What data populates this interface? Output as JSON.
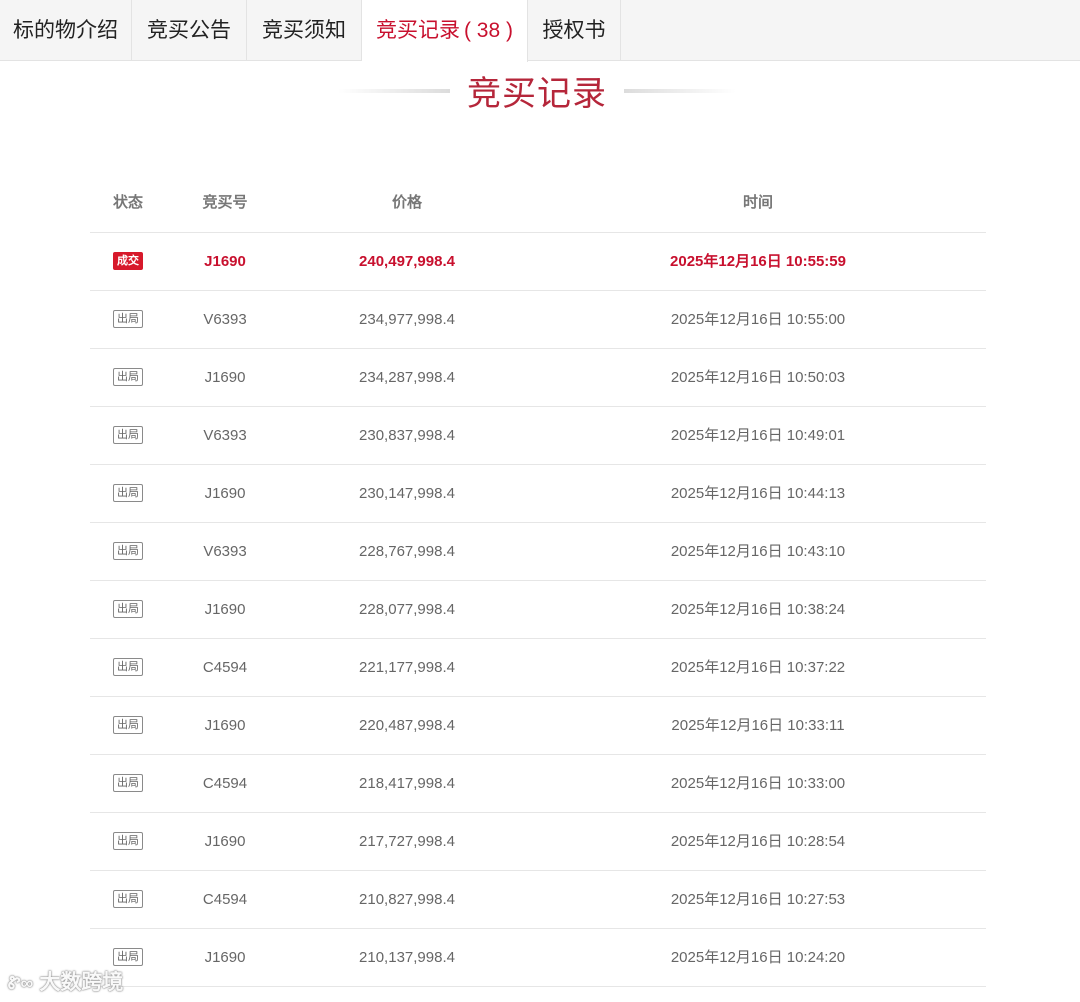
{
  "tabs": [
    {
      "label": "标的物介绍"
    },
    {
      "label": "竞买公告"
    },
    {
      "label": "竞买须知"
    },
    {
      "label": "竞买记录",
      "count": "( 38 )"
    },
    {
      "label": "授权书"
    }
  ],
  "section_title": "竞买记录",
  "table": {
    "headers": {
      "status": "状态",
      "number": "竞买号",
      "price": "价格",
      "time": "时间"
    },
    "rows": [
      {
        "status": "成交",
        "number": "J1690",
        "price": "240,497,998.4",
        "time": "2025年12月16日 10:55:59"
      },
      {
        "status": "出局",
        "number": "V6393",
        "price": "234,977,998.4",
        "time": "2025年12月16日 10:55:00"
      },
      {
        "status": "出局",
        "number": "J1690",
        "price": "234,287,998.4",
        "time": "2025年12月16日 10:50:03"
      },
      {
        "status": "出局",
        "number": "V6393",
        "price": "230,837,998.4",
        "time": "2025年12月16日 10:49:01"
      },
      {
        "status": "出局",
        "number": "J1690",
        "price": "230,147,998.4",
        "time": "2025年12月16日 10:44:13"
      },
      {
        "status": "出局",
        "number": "V6393",
        "price": "228,767,998.4",
        "time": "2025年12月16日 10:43:10"
      },
      {
        "status": "出局",
        "number": "J1690",
        "price": "228,077,998.4",
        "time": "2025年12月16日 10:38:24"
      },
      {
        "status": "出局",
        "number": "C4594",
        "price": "221,177,998.4",
        "time": "2025年12月16日 10:37:22"
      },
      {
        "status": "出局",
        "number": "J1690",
        "price": "220,487,998.4",
        "time": "2025年12月16日 10:33:11"
      },
      {
        "status": "出局",
        "number": "C4594",
        "price": "218,417,998.4",
        "time": "2025年12月16日 10:33:00"
      },
      {
        "status": "出局",
        "number": "J1690",
        "price": "217,727,998.4",
        "time": "2025年12月16日 10:28:54"
      },
      {
        "status": "出局",
        "number": "C4594",
        "price": "210,827,998.4",
        "time": "2025年12月16日 10:27:53"
      },
      {
        "status": "出局",
        "number": "J1690",
        "price": "210,137,998.4",
        "time": "2025年12月16日 10:24:20"
      }
    ]
  },
  "watermark": {
    "logo": "Ꮡ∞",
    "text": "大数跨境"
  },
  "colors": {
    "accent": "#c8102e",
    "title": "#b5263a",
    "tab_bg": "#f5f5f5"
  }
}
